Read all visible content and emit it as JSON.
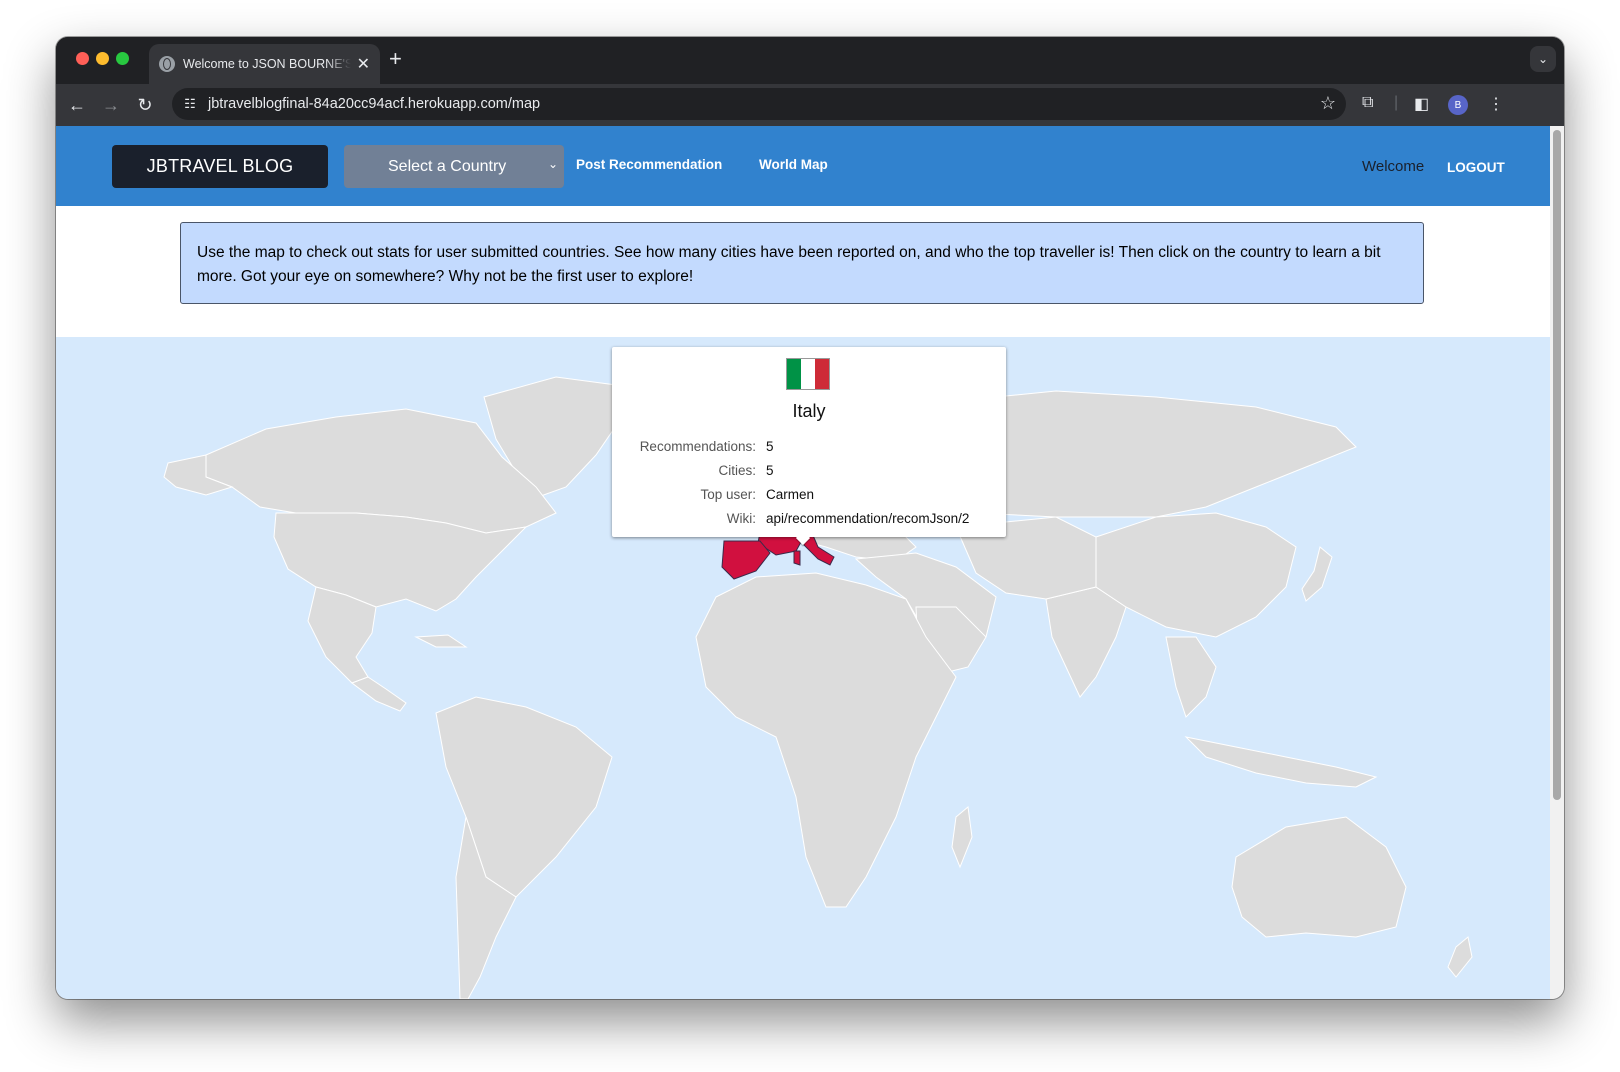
{
  "browser": {
    "tab_title": "Welcome to JSON BOURNE'S",
    "tab_icon": "globe-icon",
    "url": "jbtravelblogfinal-84a20cc94acf.herokuapp.com/map",
    "avatar_letter": "B",
    "traffic_colors": [
      "#ff5f57",
      "#febc2e",
      "#28c840"
    ]
  },
  "navbar": {
    "brand": "JBTRAVEL BLOG",
    "select_country": "Select a Country",
    "links": [
      "Post Recommendation",
      "World Map"
    ],
    "welcome": "Welcome",
    "logout": "LOGOUT",
    "color": "#3182ce"
  },
  "info_banner": {
    "text": "Use the map to check out stats for user submitted countries. See how many cities have been reported on, and who the top traveller is! Then click on the country to learn a bit more. Got your eye on somewhere? Why not be the first user to explore!"
  },
  "map": {
    "highlight_color": "#d1103f",
    "highlighted_countries": [
      "Italy",
      "Spain",
      "France"
    ],
    "tooltip": {
      "country": "Italy",
      "flag_colors": [
        "#009246",
        "#ffffff",
        "#ce2b37"
      ],
      "rows": [
        {
          "label": "Recommendations:",
          "value": "5"
        },
        {
          "label": "Cities:",
          "value": "5"
        },
        {
          "label": "Top user:",
          "value": "Carmen"
        },
        {
          "label": "Wiki:",
          "value": "api/recommendation/recomJson/2"
        }
      ]
    }
  }
}
